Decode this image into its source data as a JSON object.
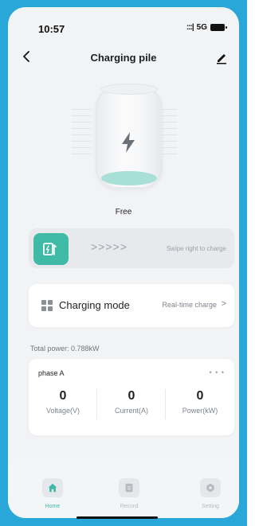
{
  "status_bar": {
    "time": "10:57",
    "network": "5G",
    "signal_glyph": ":::|"
  },
  "nav": {
    "title": "Charging pile"
  },
  "pile": {
    "state": "Free",
    "accent": "#3ebaa7"
  },
  "swipe": {
    "arrows": ">>>>>",
    "hint": "Swipe right to charge"
  },
  "mode": {
    "label": "Charging mode",
    "value": "Real-time charge",
    "chevron": ">"
  },
  "total_power": "Total power: 0.788kW",
  "phase": {
    "title": "phase A",
    "more": "• • •",
    "metrics": [
      {
        "value": "0",
        "label": "Voltage(V)"
      },
      {
        "value": "0",
        "label": "Current(A)"
      },
      {
        "value": "0",
        "label": "Power(kW)"
      }
    ]
  },
  "tabs": [
    {
      "label": "Home",
      "icon": "home-icon",
      "active": true
    },
    {
      "label": "Record",
      "icon": "record-icon",
      "active": false
    },
    {
      "label": "Setting",
      "icon": "setting-icon",
      "active": false
    }
  ]
}
